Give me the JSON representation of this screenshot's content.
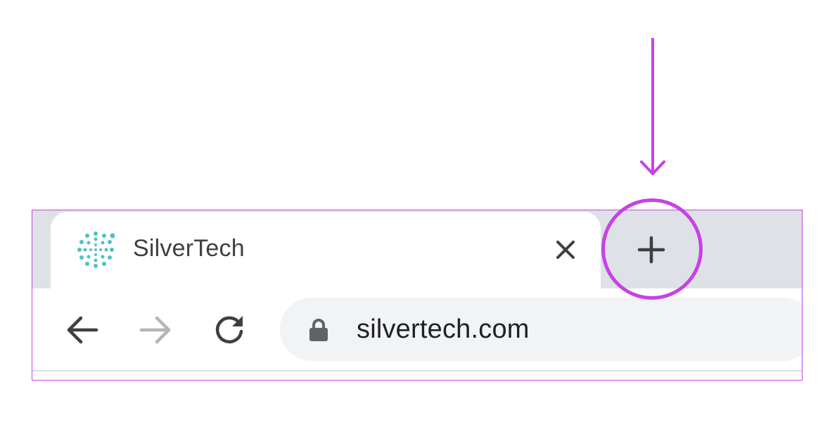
{
  "tab": {
    "title": "SilverTech",
    "favicon": "silvertech-dotted-circle-logo",
    "close_icon": "close-icon"
  },
  "tabstrip": {
    "new_tab_icon": "plus-icon"
  },
  "toolbar": {
    "back_icon": "arrow-left-icon",
    "forward_icon": "arrow-right-icon",
    "reload_icon": "reload-icon",
    "lock_icon": "lock-icon",
    "url": "silvertech.com"
  },
  "colors": {
    "annotation": "#c642e6",
    "tabstrip_bg": "#dee1e6",
    "omnibox_bg": "#f1f3f4",
    "favicon": "#4fc3c6",
    "icon_dark": "#3c4043",
    "icon_disabled": "#b3b5b8"
  }
}
